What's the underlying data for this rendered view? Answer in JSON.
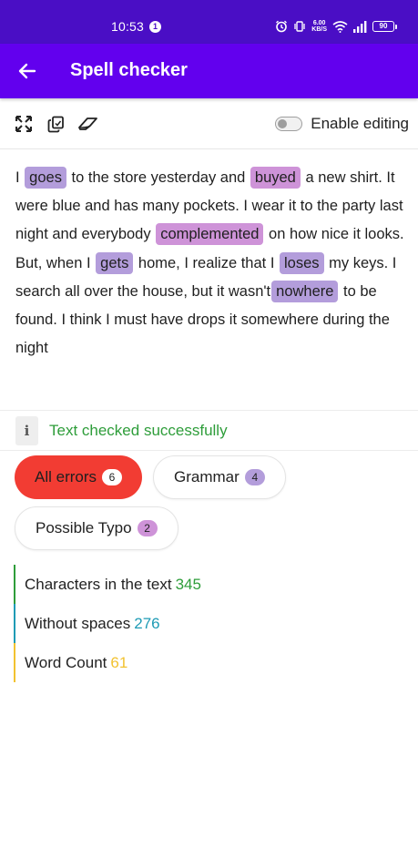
{
  "status_bar": {
    "time": "10:53",
    "notification_count": "1",
    "speed_value": "6.00",
    "speed_unit": "KB/S",
    "battery": "90"
  },
  "app_bar": {
    "title": "Spell checker",
    "back_icon": "arrow-left-icon"
  },
  "toolbar": {
    "tools": [
      "fullscreen-icon",
      "copy-icon",
      "eraser-icon"
    ],
    "edit_toggle_label": "Enable editing",
    "edit_toggle_on": false
  },
  "editor": {
    "segments": [
      {
        "text": "I "
      },
      {
        "text": "goes",
        "type": "grammar"
      },
      {
        "text": " to the store yesterday and "
      },
      {
        "text": "buyed",
        "type": "typo"
      },
      {
        "text": " a new shirt. It were blue and has many pockets. I wear it to the party last night and everybody "
      },
      {
        "text": "complemented",
        "type": "typo"
      },
      {
        "text": " on how nice it looks. But, when I "
      },
      {
        "text": "gets",
        "type": "grammar"
      },
      {
        "text": " home, I realize that I "
      },
      {
        "text": "loses",
        "type": "grammar"
      },
      {
        "text": " my keys. I search all over the house, but it wasn't"
      },
      {
        "text": "nowhere",
        "type": "grammar"
      },
      {
        "text": " to be found. I think I must have drops it somewhere during the night"
      }
    ]
  },
  "message": {
    "icon": "info-icon",
    "text": "Text checked successfully",
    "color": "#2e9d3a"
  },
  "filters": {
    "all": {
      "label": "All errors",
      "count": "6"
    },
    "grammar": {
      "label": "Grammar",
      "count": "4"
    },
    "typo": {
      "label": "Possible Typo",
      "count": "2"
    }
  },
  "stats": [
    {
      "label": "Characters in the text",
      "value": "345",
      "color": "#2e9d3a"
    },
    {
      "label": "Without spaces",
      "value": "276",
      "color": "#1f9bb5"
    },
    {
      "label": "Word Count",
      "value": "61",
      "color": "#f2c230"
    }
  ],
  "colors": {
    "status_bar": "#4a0ec5",
    "app_bar": "#6200ee",
    "grammar_highlight": "#b39ddb",
    "typo_highlight": "#ce93d8",
    "active_chip": "#f23c33"
  }
}
